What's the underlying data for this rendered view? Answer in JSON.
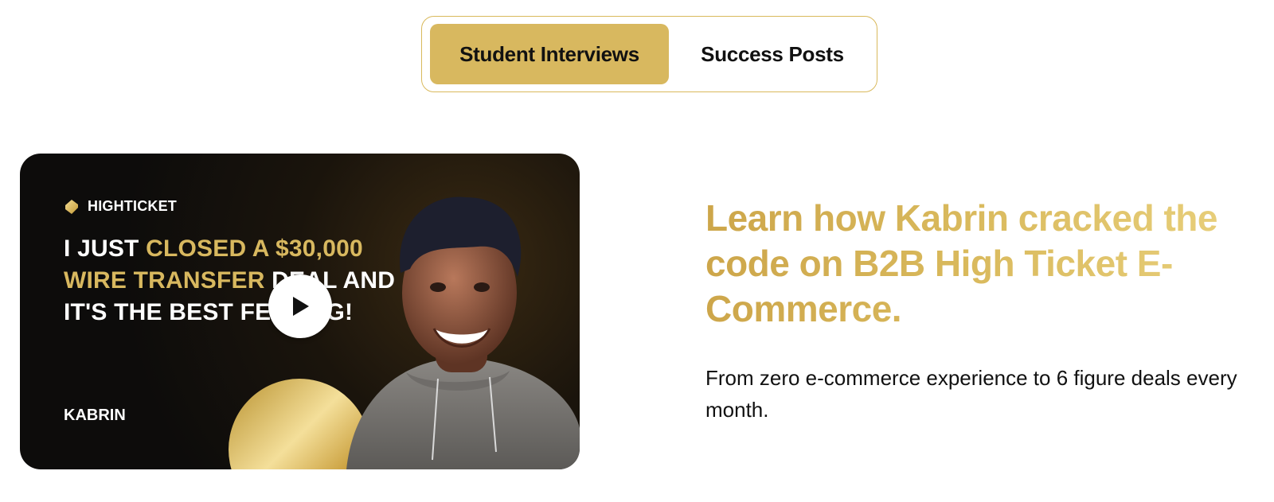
{
  "tabs": [
    {
      "label": "Student Interviews",
      "active": true
    },
    {
      "label": "Success Posts",
      "active": false
    }
  ],
  "video_card": {
    "brand": "HIGHTICKET",
    "headline": {
      "part1": "I JUST ",
      "part2": "CLOSED A $30,000 WIRE TRANSFER",
      "part3": " DEAL AND IT'S THE BEST FEELING!"
    },
    "name": "KABRIN",
    "play_icon": "play-icon"
  },
  "content": {
    "title": "Learn how Kabrin cracked the code on B2B High Ticket E-Commerce.",
    "subtitle": "From zero e-commerce experience to 6 figure deals every month."
  },
  "colors": {
    "accent_gold": "#d8b85f",
    "card_dark": "#0d0c0b"
  }
}
